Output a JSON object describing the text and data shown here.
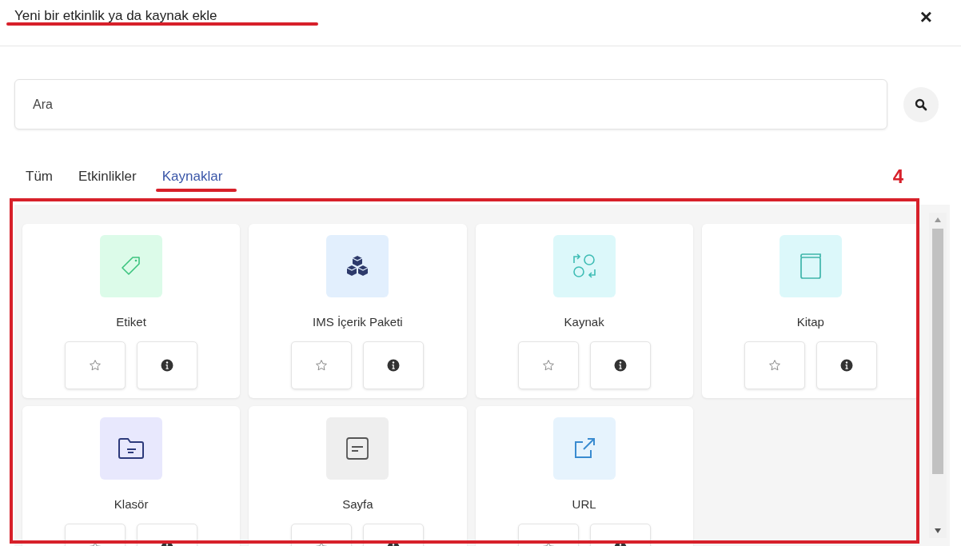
{
  "dialog": {
    "title": "Yeni bir etkinlik ya da kaynak ekle",
    "close": "×"
  },
  "search": {
    "placeholder": "Ara"
  },
  "tabs": [
    {
      "label": "Tüm",
      "selected": false
    },
    {
      "label": "Etkinlikler",
      "selected": false
    },
    {
      "label": "Kaynaklar",
      "selected": true
    }
  ],
  "annotation": {
    "number": "4"
  },
  "items": [
    {
      "name": "Etiket",
      "kind": "tag",
      "color": "#dcfbe9"
    },
    {
      "name": "IMS İçerik Paketi",
      "kind": "package",
      "color": "#e2effd"
    },
    {
      "name": "Kaynak",
      "kind": "resource",
      "color": "#dcf8fa"
    },
    {
      "name": "Kitap",
      "kind": "book",
      "color": "#dcf8fa"
    },
    {
      "name": "Klasör",
      "kind": "folder",
      "color": "#e8e8fd"
    },
    {
      "name": "Sayfa",
      "kind": "page",
      "color": "#eeeeee"
    },
    {
      "name": "URL",
      "kind": "url",
      "color": "#e6f3fd"
    }
  ]
}
